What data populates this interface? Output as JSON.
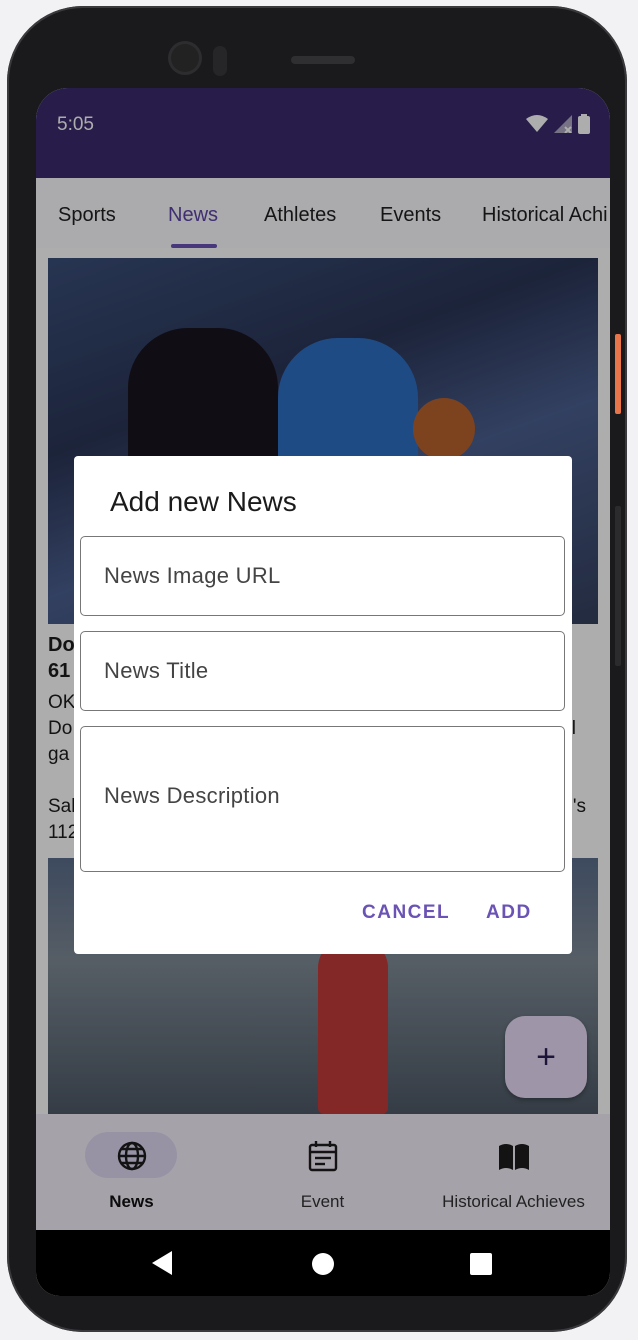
{
  "status_bar": {
    "time": "5:05"
  },
  "tabs": [
    {
      "label": "Sports"
    },
    {
      "label": "News"
    },
    {
      "label": "Athletes"
    },
    {
      "label": "Events"
    },
    {
      "label": "Historical Achi"
    }
  ],
  "article": {
    "title_partial": "Do",
    "title_line2": "61",
    "body_lines": [
      "OK",
      "Do",
      "ga",
      "",
      "Sal",
      "112"
    ],
    "right_fragments": [
      "l",
      "'s"
    ]
  },
  "bottom_nav": [
    {
      "label": "News",
      "icon": "globe-icon"
    },
    {
      "label": "Event",
      "icon": "calendar-icon"
    },
    {
      "label": "Historical Achieves",
      "icon": "book-icon"
    }
  ],
  "fab": {
    "label": "+"
  },
  "dialog": {
    "title": "Add new News",
    "fields": {
      "image_url_placeholder": "News Image URL",
      "title_placeholder": "News Title",
      "description_placeholder": "News Description"
    },
    "cancel_label": "CANCEL",
    "add_label": "ADD"
  },
  "colors": {
    "accent": "#6a53b5",
    "status_bar": "#3b2c6d"
  }
}
